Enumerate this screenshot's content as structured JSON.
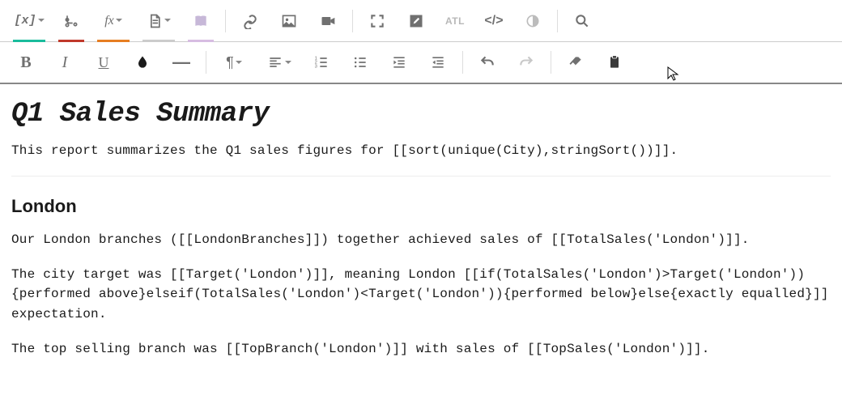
{
  "toolbar": {
    "row1": {
      "variable": "[x]",
      "branch": "branch",
      "fx": "fx",
      "doc": "doc",
      "book": "book",
      "link": "link",
      "image": "image",
      "video": "video",
      "fullscreen": "fullscreen",
      "edit": "edit",
      "alt": "ATL",
      "code": "</>",
      "contrast": "contrast",
      "search": "search"
    },
    "row2": {
      "bold": "B",
      "italic": "I",
      "underline": "U",
      "drop": "drop",
      "minus": "—",
      "pilcrow": "¶",
      "align": "align",
      "olist": "olist",
      "ulist": "ulist",
      "indent": "indent",
      "outdent": "outdent",
      "undo": "undo",
      "redo": "redo",
      "eraser": "eraser",
      "clipboard": "clipboard"
    }
  },
  "document": {
    "title": "Q1 Sales Summary",
    "intro": "This report summarizes the Q1 sales figures for [[sort(unique(City),stringSort())]].",
    "section_heading": "London",
    "p1": "Our London branches ([[LondonBranches]]) together achieved sales of [[TotalSales('London')]].",
    "p2": "The city target was [[Target('London')]], meaning London [[if(TotalSales('London')>Target('London')){performed above}elseif(TotalSales('London')<Target('London')){performed below}else{exactly equalled}]] expectation.",
    "p3": "The top selling branch was [[TopBranch('London')]] with sales of [[TopSales('London')]]."
  }
}
